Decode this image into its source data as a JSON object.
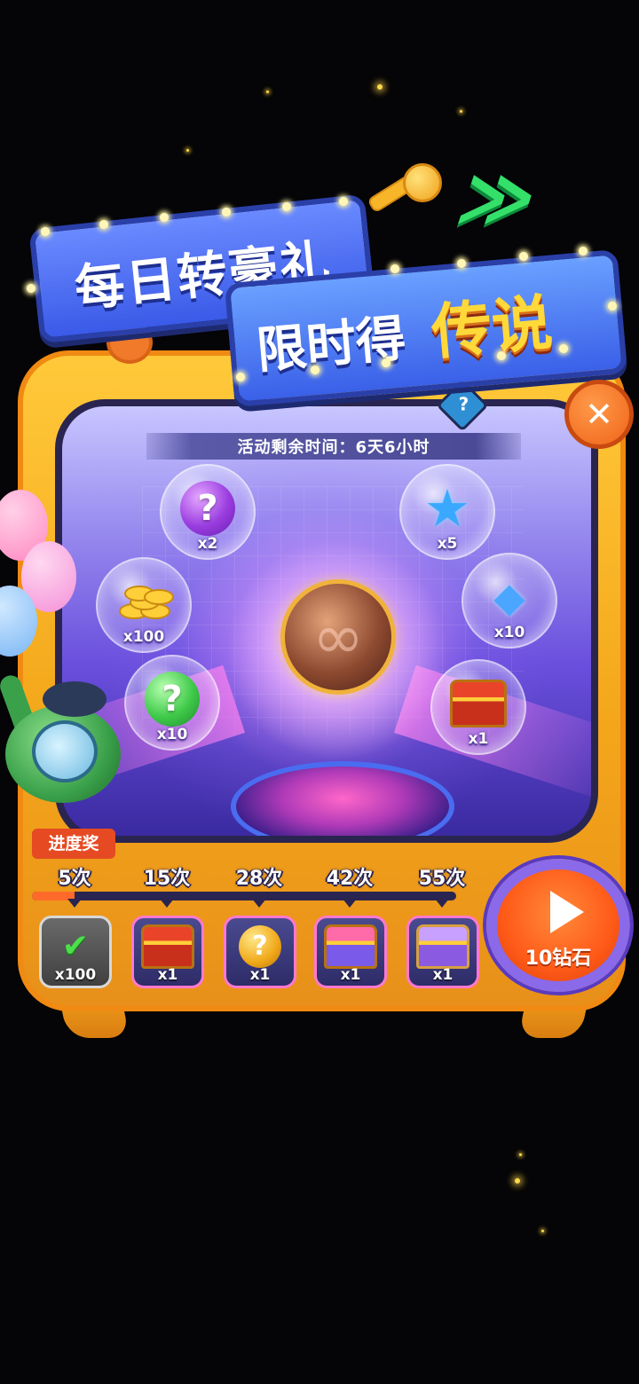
{
  "title": {
    "line1": "每日转豪礼",
    "line2_prefix": "限时得",
    "line2_highlight": "传说"
  },
  "help_label": "?",
  "close_label": "✕",
  "timer": {
    "text": "活动剩余时间：6天6小时"
  },
  "pool_items": [
    {
      "name": "purple-mystery-orb",
      "qty": "x2",
      "glyph": "?"
    },
    {
      "name": "blue-star",
      "qty": "x5",
      "glyph": "★"
    },
    {
      "name": "gold-coins",
      "qty": "x100"
    },
    {
      "name": "blue-gems",
      "qty": "x10",
      "glyph": "◆"
    },
    {
      "name": "green-mystery-orb",
      "qty": "x10",
      "glyph": "?"
    },
    {
      "name": "red-treasure-chest",
      "qty": "x1"
    }
  ],
  "center_item": {
    "name": "legendary-infinity-orb",
    "glyph": "∞"
  },
  "progress": {
    "label": "进度奖",
    "fill_fraction": 0.1,
    "milestones": [
      "5次",
      "15次",
      "28次",
      "42次",
      "55次"
    ],
    "rewards": [
      {
        "name": "silver-gem",
        "qty": "x100",
        "claimed": true,
        "check": "✔"
      },
      {
        "name": "red-chest",
        "qty": "x1"
      },
      {
        "name": "gold-mystery-coin",
        "qty": "x1",
        "glyph": "?"
      },
      {
        "name": "rainbow-chest",
        "qty": "x1"
      },
      {
        "name": "purple-chest",
        "qty": "x1"
      }
    ]
  },
  "spin_button": {
    "label": "10钻石"
  },
  "colors": {
    "tv_frame": "#f4a71b",
    "title_banner": "#3a5ae8",
    "title_highlight": "#ffd93a",
    "progress_fill": "#ff6a2a",
    "spin_button": "#ff5a18"
  }
}
